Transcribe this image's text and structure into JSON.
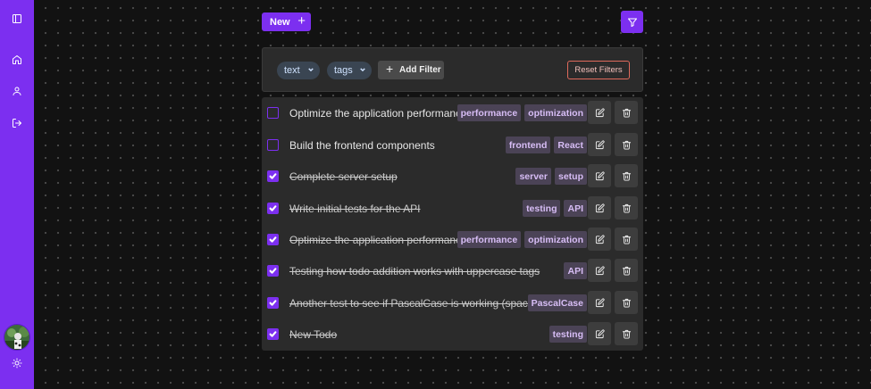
{
  "sidebar": {
    "items": [
      {
        "icon": "panel-icon"
      },
      {
        "icon": "home-icon"
      },
      {
        "icon": "user-icon"
      },
      {
        "icon": "logout-icon"
      }
    ],
    "avatar_icon": "avatar",
    "theme_icon": "sun-icon"
  },
  "toolbar": {
    "new_label": "New",
    "new_plus": "+",
    "filter_icon": "funnel-icon"
  },
  "filters": {
    "chips": [
      "text",
      "tags"
    ],
    "add_filter_label": "Add Filter",
    "add_filter_plus": "+",
    "reset_label": "Reset Filters"
  },
  "todos": [
    {
      "text": "Optimize the application performance",
      "done": false,
      "tags": [
        "performance",
        "optimization"
      ]
    },
    {
      "text": "Build the frontend components",
      "done": false,
      "tags": [
        "frontend",
        "React"
      ]
    },
    {
      "text": "Complete server setup",
      "done": true,
      "tags": [
        "server",
        "setup"
      ]
    },
    {
      "text": "Write initial tests for the API",
      "done": true,
      "tags": [
        "testing",
        "API"
      ]
    },
    {
      "text": "Optimize the application performance",
      "done": true,
      "tags": [
        "performance",
        "optimization"
      ]
    },
    {
      "text": "Testing how todo addition works with uppercase tags",
      "done": true,
      "tags": [
        "API"
      ]
    },
    {
      "text": "Another test to see if PascalCase is working (spacing)",
      "done": true,
      "tags": [
        "PascalCase"
      ]
    },
    {
      "text": "New Todo",
      "done": true,
      "tags": [
        "testing"
      ]
    }
  ],
  "colors": {
    "accent": "#7c2ff0",
    "background": "#121212",
    "panel": "#2b2b2b",
    "tag_bg": "#4b4356",
    "tag_text": "#d7bdf5",
    "reset_border": "#e06a5c"
  }
}
